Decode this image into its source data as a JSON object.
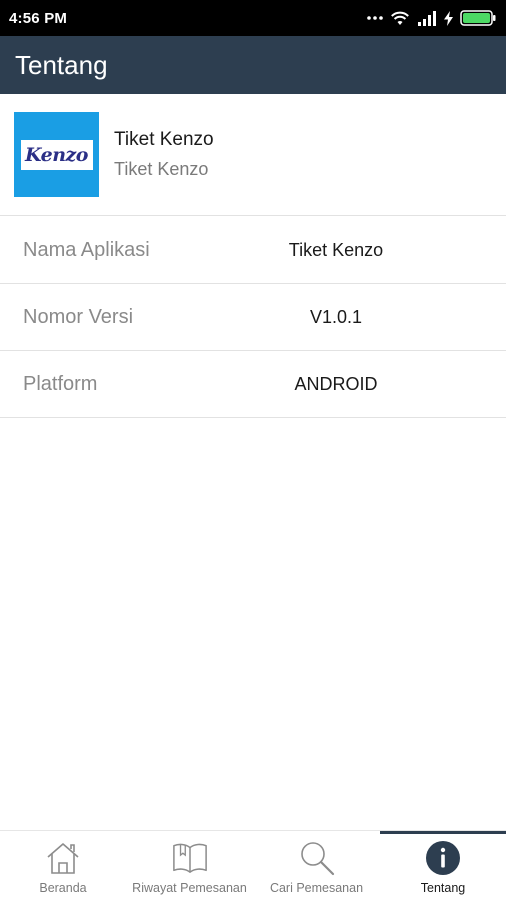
{
  "status_bar": {
    "time": "4:56 PM",
    "icons": [
      "more-dots-icon",
      "wifi-icon",
      "signal-icon",
      "charging-icon",
      "battery-icon"
    ]
  },
  "app_bar": {
    "title": "Tentang"
  },
  "app_header": {
    "logo_text": "Kenzo",
    "name": "Tiket Kenzo",
    "subname": "Tiket Kenzo"
  },
  "info": {
    "rows": [
      {
        "label": "Nama Aplikasi",
        "value": "Tiket Kenzo"
      },
      {
        "label": "Nomor Versi",
        "value": "V1.0.1"
      },
      {
        "label": "Platform",
        "value": "ANDROID"
      }
    ]
  },
  "bottom_nav": {
    "items": [
      {
        "label": "Beranda",
        "icon": "home-icon",
        "active": false
      },
      {
        "label": "Riwayat Pemesanan",
        "icon": "book-icon",
        "active": false
      },
      {
        "label": "Cari Pemesanan",
        "icon": "search-icon",
        "active": false
      },
      {
        "label": "Tentang",
        "icon": "info-icon",
        "active": true
      }
    ]
  },
  "colors": {
    "app_bar": "#2d3e50",
    "logo_bg": "#1a9ee4",
    "logo_text": "#2b2f86",
    "battery": "#4cd964"
  }
}
